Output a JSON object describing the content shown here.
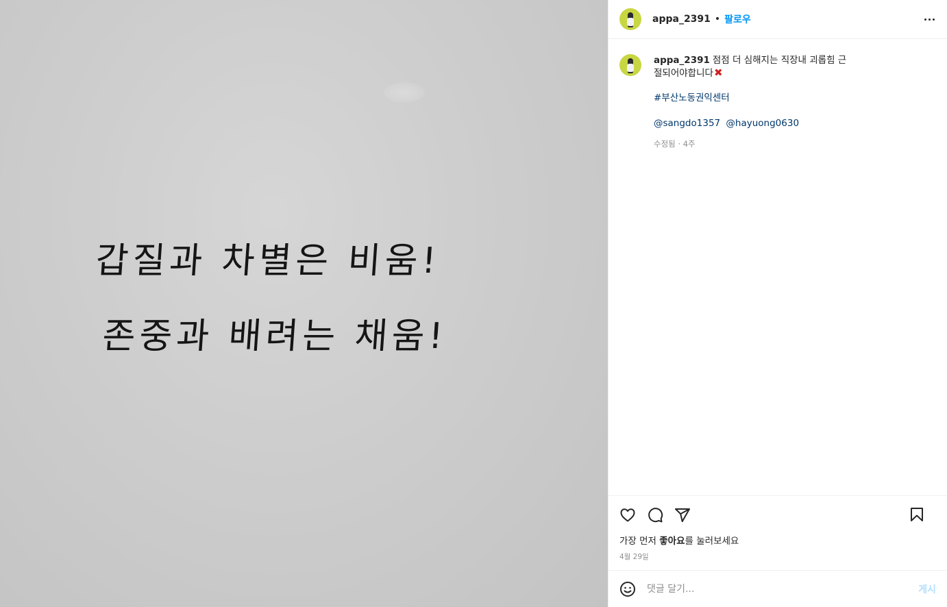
{
  "photo": {
    "line1": "갑질과 차별은 비움!",
    "line2": "존중과 배려는 채움!"
  },
  "header": {
    "username": "appa_2391",
    "separator": "•",
    "follow_label": "팔로우",
    "more_icon": "more-horizontal-icon"
  },
  "caption": {
    "username": "appa_2391",
    "text": "점점 더 심해지는 직장내 괴롭힘 근절되어야합니다",
    "emoji": "✖",
    "hashtag": "#부산노동권익센터",
    "mentions": [
      "@sangdo1357",
      "@hayuong0630"
    ],
    "meta": "수정됨 · 4주"
  },
  "actions": {
    "like_icon": "heart-icon",
    "comment_icon": "comment-icon",
    "share_icon": "share-icon",
    "save_icon": "bookmark-icon"
  },
  "likes": {
    "prefix": "가장 먼저 ",
    "bold": "좋아요",
    "suffix": "를 눌러보세요"
  },
  "date": "4월 29일",
  "comment": {
    "placeholder": "댓글 달기...",
    "post_label": "게시",
    "emoji_icon": "smiley-icon"
  },
  "colors": {
    "accent": "#0095f6",
    "link": "#00376b",
    "muted": "#8e8e8e",
    "post_disabled": "#b2dffc"
  }
}
